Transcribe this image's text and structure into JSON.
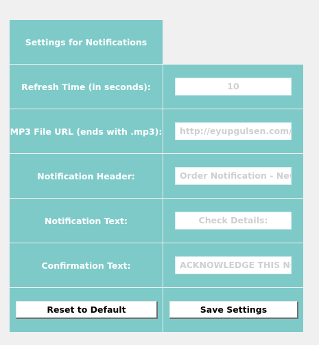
{
  "header": {
    "title": "Settings for Notifications"
  },
  "rows": [
    {
      "label": "Refresh Time (in seconds):",
      "value": "10"
    },
    {
      "label": "MP3 File URL (ends with .mp3):",
      "value": "http://eyupgulsen.com/t"
    },
    {
      "label": "Notification Header:",
      "value": "Order Notification - New"
    },
    {
      "label": "Notification Text:",
      "value": "Check Details:"
    },
    {
      "label": "Confirmation Text:",
      "value": "ACKNOWLEDGE THIS NOT"
    }
  ],
  "buttons": {
    "reset": "Reset to Default",
    "save": "Save Settings"
  }
}
